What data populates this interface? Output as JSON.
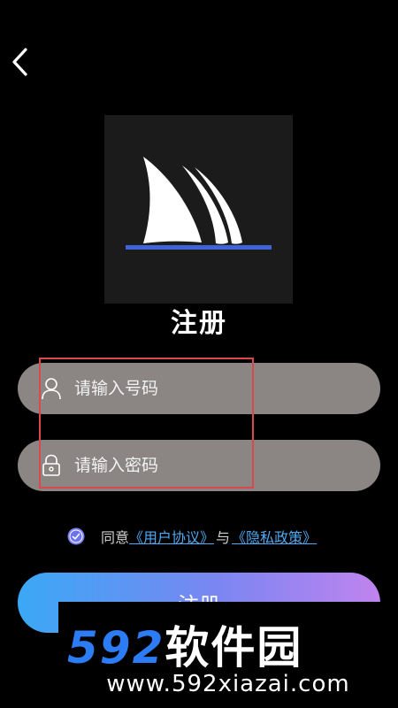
{
  "header": {
    "back_icon": "chevron-left-icon"
  },
  "logo": {
    "icon": "sail-logo-icon",
    "sail_color": "#ffffff",
    "base_color": "#3f63d6"
  },
  "title": "注册",
  "phone_field": {
    "icon": "user-icon",
    "placeholder": "请输入号码",
    "value": ""
  },
  "password_field": {
    "icon": "lock-icon",
    "placeholder": "请输入密码",
    "value": ""
  },
  "agreement": {
    "checked": true,
    "prefix": "同意",
    "user_agreement": "《用户协议》",
    "separator": "与",
    "privacy_policy": "《隐私政策》"
  },
  "register_button": {
    "label": "注册"
  },
  "watermark": {
    "digits": "592",
    "name": "软件园",
    "url": "www.592xiazai.com"
  },
  "colors": {
    "accent": "#4ea8f2",
    "highlight": "#d9474f",
    "button_start": "#3aa8f5",
    "button_end": "#c083ee"
  }
}
